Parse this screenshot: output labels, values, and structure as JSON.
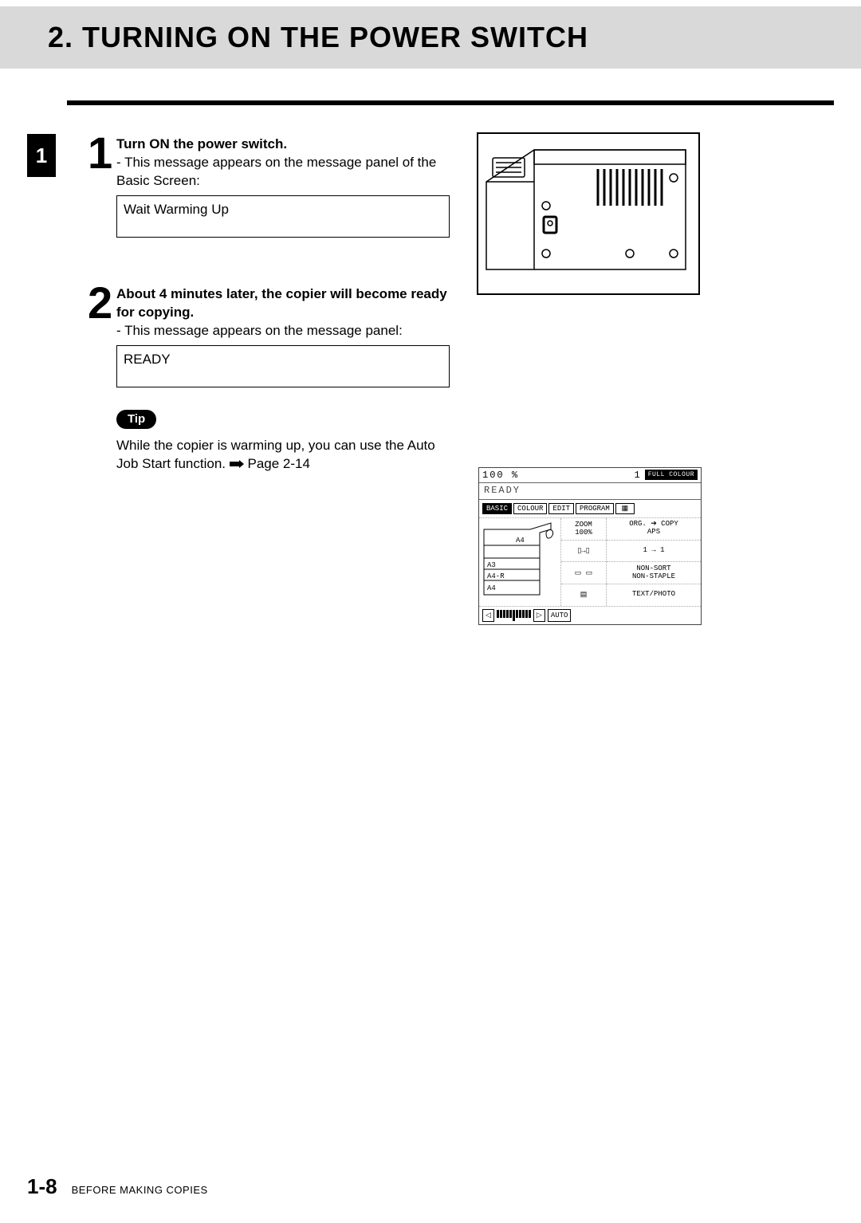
{
  "header": {
    "number": "2.",
    "title": "TURNING ON THE POWER SWITCH"
  },
  "chapter_tab": "1",
  "steps": [
    {
      "num": "1",
      "title": "Turn ON the power switch.",
      "desc_prefix": "- ",
      "desc": "This message appears on the message panel of the Basic Screen:",
      "message": "Wait  Warming Up"
    },
    {
      "num": "2",
      "title": "About 4 minutes later, the copier will become ready for copying.",
      "desc_prefix": "- ",
      "desc": "This message appears on the message panel:",
      "message": "READY"
    }
  ],
  "tip": {
    "label": "Tip",
    "text_a": "While the copier is warming up, you can use the Auto Job Start function.",
    "text_b": "Page 2-14"
  },
  "display_panel": {
    "zoom_pct": "100",
    "pct_sign": "%",
    "qty": "1",
    "full_colour": "FULL COLOUR",
    "ready": "READY",
    "tabs": [
      "BASIC",
      "COLOUR",
      "EDIT",
      "PROGRAM"
    ],
    "paper_sizes": [
      "A4",
      "A3",
      "A4-R",
      "A4"
    ],
    "mid": {
      "zoom_label": "ZOOM",
      "zoom_value": "100%"
    },
    "right": {
      "org_copy": "ORG. ➔ COPY",
      "aps": "APS",
      "ratio": "1 → 1",
      "nonsort": "NON-SORT",
      "nonstaple": "NON-STAPLE",
      "textphoto": "TEXT/PHOTO"
    },
    "bottom": {
      "auto": "AUTO"
    }
  },
  "footer": {
    "page": "1-8",
    "section": "BEFORE MAKING COPIES"
  }
}
